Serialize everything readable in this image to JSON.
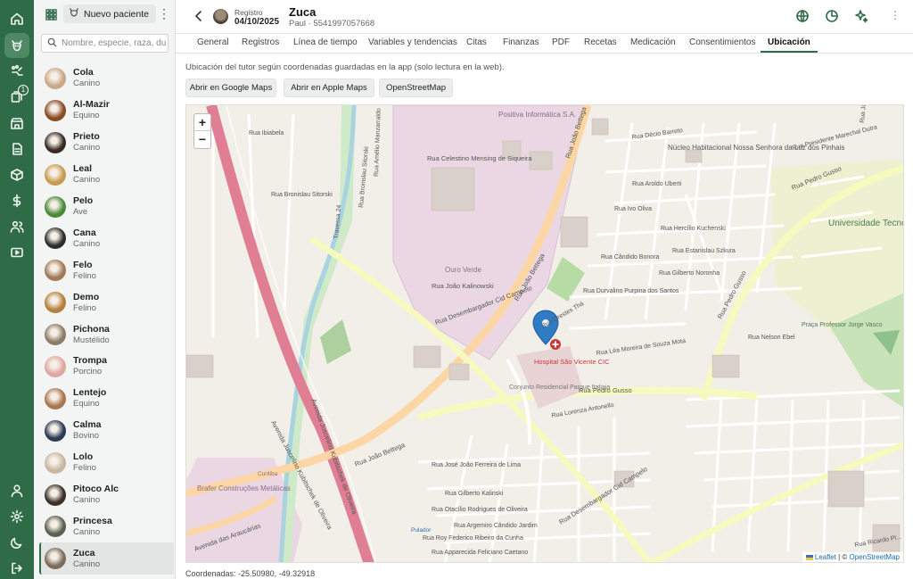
{
  "rail": {
    "items": [
      {
        "icon": "home-icon"
      },
      {
        "icon": "pet-icon",
        "active": true
      },
      {
        "icon": "paw-routes-icon"
      },
      {
        "icon": "queue-icon",
        "badge": "1"
      },
      {
        "icon": "clinic-icon"
      },
      {
        "icon": "document-icon"
      },
      {
        "icon": "box-icon"
      },
      {
        "icon": "dollar-icon"
      },
      {
        "icon": "people-icon"
      },
      {
        "icon": "video-icon"
      }
    ],
    "bottom": [
      {
        "icon": "user-icon"
      },
      {
        "icon": "settings-icon"
      },
      {
        "icon": "moon-icon"
      },
      {
        "icon": "logout-icon"
      }
    ]
  },
  "sidebar": {
    "new_patient_label": "Nuevo paciente",
    "search_placeholder": "Nombre, especie, raza, du",
    "patients": [
      {
        "name": "Cola",
        "species": "Canino",
        "color": "#c9a98a"
      },
      {
        "name": "Al-Mazir",
        "species": "Equino",
        "color": "#8a4a26"
      },
      {
        "name": "Prieto",
        "species": "Canino",
        "color": "#3a2a22"
      },
      {
        "name": "Leal",
        "species": "Canino",
        "color": "#c99b52"
      },
      {
        "name": "Pelo",
        "species": "Ave",
        "color": "#4c8a3a"
      },
      {
        "name": "Cana",
        "species": "Canino",
        "color": "#2d2d2d"
      },
      {
        "name": "Felo",
        "species": "Felino",
        "color": "#a07a55"
      },
      {
        "name": "Demo",
        "species": "Felino",
        "color": "#b5803e"
      },
      {
        "name": "Pichona",
        "species": "Mustélido",
        "color": "#8f7b66"
      },
      {
        "name": "Trompa",
        "species": "Porcino",
        "color": "#e0a7a0"
      },
      {
        "name": "Lentejo",
        "species": "Equino",
        "color": "#a8764f"
      },
      {
        "name": "Calma",
        "species": "Bovino",
        "color": "#2b3a55"
      },
      {
        "name": "Lolo",
        "species": "Felino",
        "color": "#c9b7a2"
      },
      {
        "name": "Pitoco Alc",
        "species": "Canino",
        "color": "#3b2f28"
      },
      {
        "name": "Princesa",
        "species": "Canino",
        "color": "#5a5f4f"
      },
      {
        "name": "Zuca",
        "species": "Canino",
        "color": "#7d6c5c",
        "selected": true
      }
    ]
  },
  "header": {
    "registro_label": "Registro",
    "registro_date": "04/10/2025",
    "patient_name": "Zuca",
    "owner_line": "Paul · 5541997057668"
  },
  "tabs": [
    "General",
    "Registros",
    "Línea de tiempo",
    "Variables y tendencias",
    "Citas",
    "Finanzas",
    "PDF",
    "Recetas",
    "Medicación",
    "Consentimientos",
    "Ubicación"
  ],
  "active_tab": "Ubicación",
  "location": {
    "info_text": "Ubicación del tutor según coordenadas guardadas en la app (solo lectura en la web).",
    "buttons": [
      "Abrir en Google Maps",
      "Abrir en Apple Maps",
      "OpenStreetMap"
    ],
    "coordinates_text": "Coordenadas: -25.50980, -49.32918"
  },
  "map": {
    "zoom_in": "+",
    "zoom_out": "−",
    "attribution_leaflet": "Leaflet",
    "attribution_sep": " | © ",
    "attribution_osm": "OpenStreetMap",
    "labels": {
      "positiva": "Positiva Informática S.A.",
      "ouro_verde": "Ouro Verde",
      "nucleo": "Núcleo Habitacional Nossa Senhora da Luz dos Pinhais",
      "utfpr": "Universidade Tecnológica Federal do Paraná | Campus Curitiba - Sede Neoville",
      "hospital": "Hospital São Vicente CIC",
      "conjunto": "Conjunto Residencial Parque Itatiaia",
      "brafer": "Brafer Construções Metálicas",
      "praca": "Praça Professor Jorge Vasco",
      "av_juscelino": "Avenida Juscelino Kubitschek de Oliveira",
      "av_juscelino2": "Avenida Juscelino Kubitschek de Oliveira",
      "rua_joao_bettega": "Rua João Bettega",
      "rua_joao_bettega2": "Rua João Bettega",
      "rua_joao_bettega3": "Rua João Bettega",
      "rua_pedro_gusso": "Rua Pedro Gusso",
      "rua_pedro_gusso2": "Rua Pedro Gusso",
      "rua_pedro_gusso3": "Rua Pedro Gusso",
      "rua_des_cid": "Rua Desembargador Cid Campelo",
      "rua_des_cid2": "Rua Desembargador Cid Campelo",
      "av_araucarias": "Avenida das Araucárias",
      "rua_celestino": "Rua Celestino Mensing de Siqueira",
      "rua_joao_kalinowski": "Rua João Kalinowski",
      "rua_orestes": "Rua Orestes Thá",
      "rua_bronislau": "Rua Bronislau Sitorski",
      "rua_decio": "Rua Décio Barreto",
      "rua_presidente": "Rua Presidente Marechal Dutra",
      "rua_lea": "Rua Léa Moreira de Souza Mota",
      "rua_jose": "Rua José João Ferreira de Lima",
      "rua_gilberto": "Rua Gilberto Kalinski",
      "rua_otavio": "Rua Otacílio Rodrigues de Oliveira",
      "rua_argemiro": "Rua Argemiro Cândido Jardim",
      "rua_roy": "Rua Roy Federico Ribeiro da Cunha",
      "rua_apparecida": "Rua Apparecida Feliciano Caetano",
      "rua_nelson": "Rua Nelson Ebel",
      "rua_ibiabela": "Rua Ibiabela",
      "rua_hercilio": "Rua Hercílio Kuchenski",
      "rua_estanislau": "Rua Estanislau Szkura",
      "rua_durvalino": "Rua Durvalino Purpina dos Santos",
      "rua_gilberto_n": "Rua Gilberto Noronha",
      "rua_candido": "Rua Cândido Bonora",
      "rua_ivo": "Rua Ivo Oliva",
      "rua_aroldo": "Rua Aroldo Uberti",
      "rua_lorena": "Rua Lorenza Antonello",
      "rua_pulador": "Pulador",
      "curitiba": "Curitiba",
      "rua_manzarraldo": "Rua Amélio Manzarraldo",
      "rua_bronislau_v": "Rua Bronislau Sitorski",
      "rua_travessa": "Travessa 24",
      "rua_ricardo": "Rua Ricardo Pl...",
      "rua_joao_g": "Rua João Gusso"
    }
  }
}
